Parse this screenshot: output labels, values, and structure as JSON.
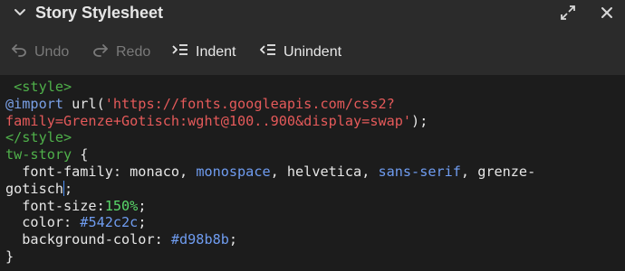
{
  "header": {
    "title": "Story Stylesheet"
  },
  "toolbar": {
    "undo_label": "Undo",
    "redo_label": "Redo",
    "indent_label": "Indent",
    "unindent_label": "Unindent"
  },
  "editor": {
    "l1_open_tag": " <style>",
    "l2_at": "@import",
    "l2_url": " url(",
    "l2_str": "'https://fonts.googleapis.com/css2?",
    "l3_str": "family=Grenze+Gotisch:wght@100..900&display=swap'",
    "l3_end": ");",
    "l4_close_tag": "</style>",
    "l5_selector": "tw-story",
    "l5_brace": " {",
    "l6_prop": "  font-family: monaco, ",
    "l6_val1": "monospace",
    "l6_sep1": ", helvetica, ",
    "l6_val2": "sans-serif",
    "l6_sep2": ", grenze-",
    "l7_text": "gotisch",
    "l7_semi": ";",
    "l8_prop": "  font-size:",
    "l8_val": "150%",
    "l8_semi": ";",
    "l9_prop": "  color: ",
    "l9_val": "#542c2c",
    "l9_semi": ";",
    "l10_prop": "  background-color: ",
    "l10_val": "#d98b8b",
    "l10_semi": ";",
    "l11_brace": "}"
  },
  "icons": {
    "collapse": "chevron-down-icon",
    "expand": "expand-icon",
    "close": "close-icon",
    "undo": "undo-icon",
    "redo": "redo-icon",
    "indent": "indent-icon",
    "unindent": "unindent-icon"
  },
  "colors": {
    "panel_bg": "#2b2b2b",
    "editor_bg": "#1c1c1c",
    "tag": "#4fb04a",
    "string": "#e55a5a",
    "keyword": "#6f9cf0",
    "number": "#59d86a",
    "caret": "#4d8ff5"
  }
}
